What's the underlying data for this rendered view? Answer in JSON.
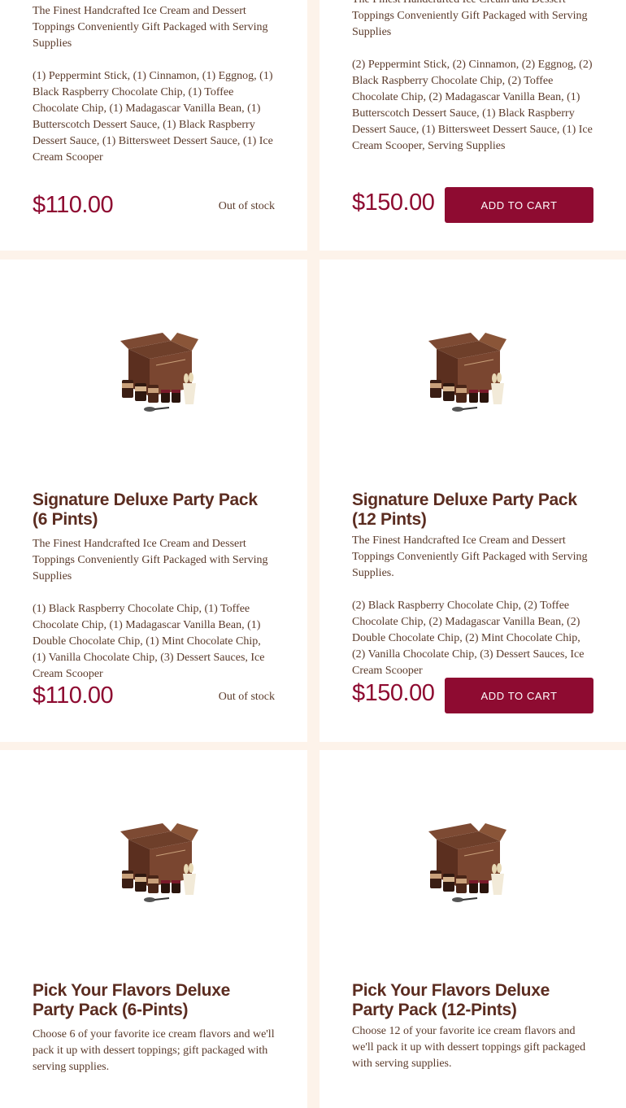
{
  "products": [
    {
      "title": "",
      "tagline": "The Finest Handcrafted Ice Cream and Dessert Toppings Conveniently Gift Packaged with Serving Supplies",
      "contents": "(1) Peppermint Stick, (1) Cinnamon, (1) Eggnog, (1) Black Raspberry Chocolate Chip, (1) Toffee Chocolate Chip, (1) Madagascar Vanilla Bean, (1) Butterscotch Dessert Sauce, (1) Black Raspberry Dessert Sauce, (1) Bittersweet Dessert Sauce, (1) Ice Cream Scooper",
      "price": "$110.00",
      "status": "Out of stock"
    },
    {
      "title": "",
      "tagline": "The Finest Handcrafted Ice Cream and Dessert Toppings Conveniently Gift Packaged with Serving Supplies",
      "contents": "(2) Peppermint Stick, (2) Cinnamon, (2) Eggnog, (2) Black Raspberry Chocolate Chip, (2) Toffee Chocolate Chip, (2) Madagascar Vanilla Bean, (1) Butterscotch Dessert Sauce, (1) Black Raspberry Dessert Sauce, (1) Bittersweet Dessert Sauce, (1) Ice Cream Scooper, Serving Supplies",
      "price": "$150.00",
      "button": "ADD TO CART"
    },
    {
      "title": "Signature Deluxe Party Pack (6 Pints)",
      "tagline": "The Finest Handcrafted Ice Cream and Dessert Toppings Conveniently Gift Packaged with Serving Supplies",
      "contents": "(1) Black Raspberry Chocolate Chip, (1) Toffee Chocolate Chip, (1) Madagascar Vanilla Bean, (1) Double Chocolate Chip, (1) Mint Chocolate Chip, (1) Vanilla Chocolate Chip, (3) Dessert Sauces, Ice Cream Scooper",
      "price": "$110.00",
      "status": "Out of stock"
    },
    {
      "title": "Signature Deluxe Party Pack (12 Pints)",
      "tagline": "The Finest Handcrafted Ice Cream and Dessert Toppings Conveniently Gift Packaged with Serving Supplies.",
      "contents": "(2) Black Raspberry Chocolate Chip, (2) Toffee Chocolate Chip, (2) Madagascar Vanilla Bean, (2) Double Chocolate Chip, (2) Mint Chocolate Chip, (2) Vanilla Chocolate Chip, (3) Dessert Sauces, Ice Cream Scooper",
      "price": "$150.00",
      "button": "ADD TO CART"
    },
    {
      "title": "Pick Your Flavors Deluxe Party Pack (6-Pints)",
      "tagline": "Choose 6 of your favorite ice cream flavors and we'll pack it up with dessert toppings; gift packaged with serving supplies."
    },
    {
      "title": "Pick Your Flavors Deluxe Party Pack (12-Pints)",
      "tagline": "Choose 12 of your favorite ice cream flavors and we'll pack it up with dessert toppings gift packaged with serving supplies."
    }
  ],
  "icons": {
    "product_image": "gift-box-party-pack-image"
  },
  "colors": {
    "accent": "#8e0b31",
    "background": "#fdf3ea",
    "text": "#5a3a2a"
  }
}
